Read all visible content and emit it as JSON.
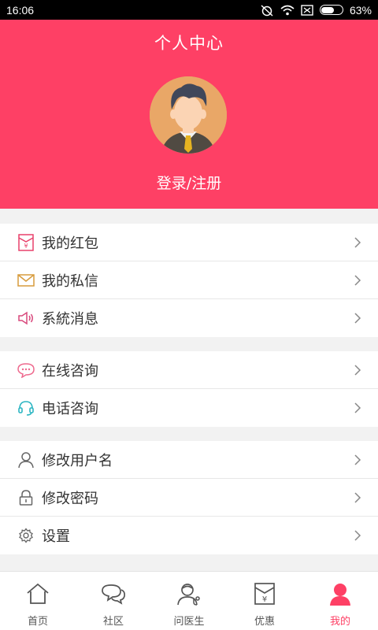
{
  "status_bar": {
    "time": "16:06",
    "battery": "63%",
    "battery_level": 0.63
  },
  "header": {
    "title": "个人中心",
    "login_label": "登录/注册"
  },
  "menu_groups": [
    {
      "items": [
        {
          "label": "我的红包",
          "icon": "red-envelope-icon"
        },
        {
          "label": "我的私信",
          "icon": "mail-icon"
        },
        {
          "label": "系統消息",
          "icon": "speaker-icon"
        }
      ]
    },
    {
      "items": [
        {
          "label": "在线咨询",
          "icon": "chat-bubble-icon"
        },
        {
          "label": "电话咨询",
          "icon": "headset-icon"
        }
      ]
    },
    {
      "items": [
        {
          "label": "修改用户名",
          "icon": "user-icon"
        },
        {
          "label": "修改密码",
          "icon": "lock-icon"
        },
        {
          "label": "设置",
          "icon": "gear-icon"
        }
      ]
    }
  ],
  "tabs": [
    {
      "label": "首页",
      "icon": "home-icon",
      "active": false
    },
    {
      "label": "社区",
      "icon": "community-icon",
      "active": false
    },
    {
      "label": "问医生",
      "icon": "doctor-icon",
      "active": false
    },
    {
      "label": "优惠",
      "icon": "coupon-icon",
      "active": false
    },
    {
      "label": "我的",
      "icon": "profile-icon",
      "active": true
    }
  ],
  "colors": {
    "accent": "#fe4065",
    "text": "#333333",
    "background": "#f2f2f2"
  }
}
